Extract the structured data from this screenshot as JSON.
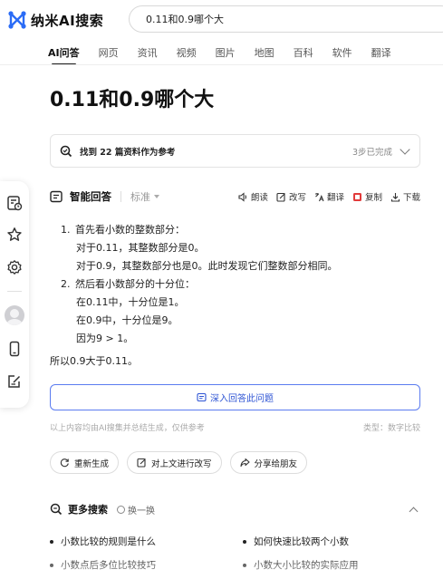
{
  "header": {
    "logo_text": "纳米AI搜索",
    "search_value": "0.11和0.9哪个大"
  },
  "tabs": [
    {
      "label": "AI问答",
      "active": true
    },
    {
      "label": "网页"
    },
    {
      "label": "资讯"
    },
    {
      "label": "视频"
    },
    {
      "label": "图片"
    },
    {
      "label": "地图"
    },
    {
      "label": "百科"
    },
    {
      "label": "软件"
    },
    {
      "label": "翻译"
    }
  ],
  "page_title": "0.11和0.9哪个大",
  "sources": {
    "text": "找到 22 篇资料作为参考",
    "steps": "3步已完成"
  },
  "answer": {
    "title": "智能回答",
    "mode": "标准",
    "actions": {
      "read": "朗读",
      "rewrite": "改写",
      "translate": "翻译",
      "copy": "复制",
      "download": "下载"
    },
    "steps": [
      {
        "num": "1.",
        "text": "首先看小数的整数部分：",
        "lines": [
          "对于0.11，其整数部分是0。",
          "对于0.9，其整数部分也是0。此时发现它们整数部分相同。"
        ]
      },
      {
        "num": "2.",
        "text": "然后看小数部分的十分位：",
        "lines": [
          "在0.11中，十分位是1。",
          "在0.9中，十分位是9。",
          "因为9 > 1。"
        ]
      }
    ],
    "conclusion": "所以0.9大于0.11。",
    "deep_button": "深入回答此问题",
    "disclaimer": "以上内容均由AI搜集并总结生成，仅供参考",
    "type_label": "类型：数字比较"
  },
  "pills": {
    "regenerate": "重新生成",
    "rewrite_above": "对上文进行改写",
    "share": "分享给朋友"
  },
  "more": {
    "title": "更多搜索",
    "refresh": "换一换",
    "items": [
      "小数比较的规则是什么",
      "如何快速比较两个小数",
      "小数点后多位比较技巧",
      "小数大小比较的实际应用"
    ]
  },
  "colors": {
    "accent_blue": "#2f55d4",
    "logo_blue": "#2b6cf6"
  }
}
